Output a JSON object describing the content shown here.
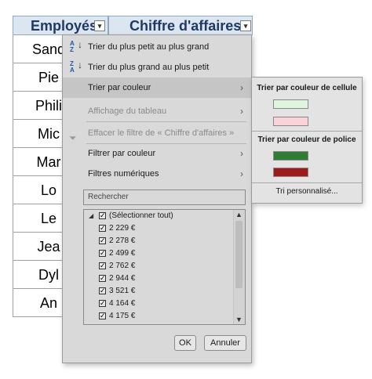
{
  "columns": {
    "a": {
      "label": "Employés"
    },
    "b": {
      "label": "Chiffre d'affaires"
    },
    "dropdown_glyph": "▾"
  },
  "cells": [
    "Sand",
    "Pie",
    "Phili",
    "Mic",
    "Mar",
    "Lo",
    "Le",
    "Jea",
    "Dyl",
    "An"
  ],
  "menu": {
    "sort_asc_label": "Trier du plus petit au plus grand",
    "sort_desc_label": "Trier du plus grand au plus petit",
    "sort_asc_icon_text": "A\nZ",
    "sort_desc_icon_text": "Z\nA",
    "sort_by_color_label": "Trier par couleur",
    "table_view_label": "Affichage du tableau",
    "clear_filter_label": "Effacer le filtre de « Chiffre d'affaires »",
    "filter_by_color_label": "Filtrer par couleur",
    "number_filters_label": "Filtres numériques",
    "arrow_glyph": "›",
    "search_placeholder": "Rechercher",
    "list_items": [
      {
        "label": "(Sélectionner tout)",
        "checked": true,
        "select_all": true
      },
      {
        "label": "2 229 €",
        "checked": true
      },
      {
        "label": "2 278 €",
        "checked": true
      },
      {
        "label": "2 499 €",
        "checked": true
      },
      {
        "label": "2 762 €",
        "checked": true
      },
      {
        "label": "2 944 €",
        "checked": true
      },
      {
        "label": "3 521 €",
        "checked": true
      },
      {
        "label": "4 164 €",
        "checked": true
      },
      {
        "label": "4 175 €",
        "checked": true
      }
    ],
    "ok_label": "OK",
    "cancel_label": "Annuler"
  },
  "submenu": {
    "cell_color_header": "Trier par couleur de cellule",
    "font_color_header": "Trier par couleur de police",
    "cell_colors": [
      "#dff5df",
      "#f9d3d9"
    ],
    "font_colors": [
      "#2e7d32",
      "#9e1b1b"
    ],
    "custom_sort_label": "Tri personnalisé..."
  }
}
